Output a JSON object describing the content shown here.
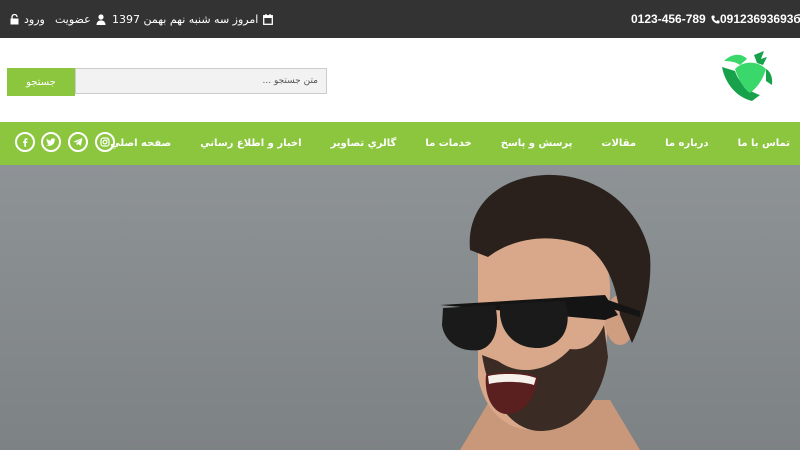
{
  "topbar": {
    "login_label": "ورود",
    "register_label": "عضویت",
    "date_text": "امروز سه شنبه نهم بهمن 1397",
    "phone_1": "0123-456-789",
    "phone_2": "09123693693б"
  },
  "search": {
    "placeholder": "متن جستجو ...",
    "button_label": "جستجو"
  },
  "nav": {
    "items": [
      {
        "label": "صفحه اصلي"
      },
      {
        "label": "اخبار و اطلاع رساني"
      },
      {
        "label": "گالري تصاوير"
      },
      {
        "label": "خدمات ما"
      },
      {
        "label": "پرسش و پاسخ"
      },
      {
        "label": "مقالات"
      },
      {
        "label": "درباره ما"
      },
      {
        "label": "تماس با ما"
      }
    ]
  },
  "social_icons": [
    "instagram-icon",
    "telegram-icon",
    "twitter-icon",
    "facebook-icon"
  ],
  "colors": {
    "accent": "#8cc63f",
    "topbar_bg": "#333333",
    "logo_green_light": "#3ad86a",
    "logo_green_dark": "#17a14a"
  }
}
